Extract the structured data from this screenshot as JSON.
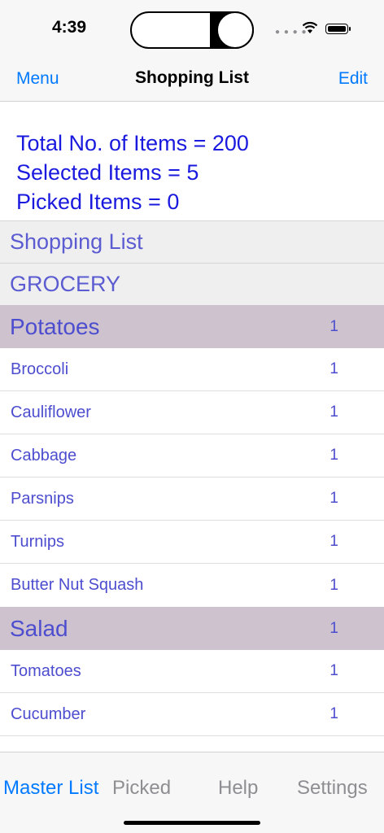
{
  "status": {
    "time": "4:39"
  },
  "nav": {
    "left": "Menu",
    "title": "Shopping List",
    "right": "Edit"
  },
  "summary": {
    "total": "Total No. of Items = 200",
    "selected": "Selected Items = 5",
    "picked": "Picked Items = 0"
  },
  "list": {
    "header": "Shopping List",
    "category": "GROCERY",
    "groups": [
      {
        "name": "Potatoes",
        "qty": "1",
        "items": [
          {
            "name": "Broccoli",
            "qty": "1"
          },
          {
            "name": "Cauliflower",
            "qty": "1"
          },
          {
            "name": "Cabbage",
            "qty": "1"
          },
          {
            "name": "Parsnips",
            "qty": "1"
          },
          {
            "name": "Turnips",
            "qty": "1"
          },
          {
            "name": "Butter Nut Squash",
            "qty": "1"
          }
        ]
      },
      {
        "name": "Salad",
        "qty": "1",
        "items": [
          {
            "name": "Tomatoes",
            "qty": "1"
          },
          {
            "name": "Cucumber",
            "qty": "1"
          }
        ]
      }
    ]
  },
  "tabs": [
    "Master List",
    "Picked",
    "Help",
    "Settings"
  ],
  "colors": {
    "accent": "#007aff",
    "text_blue": "#1a1adf",
    "group_bg": "#cdc2cd"
  }
}
